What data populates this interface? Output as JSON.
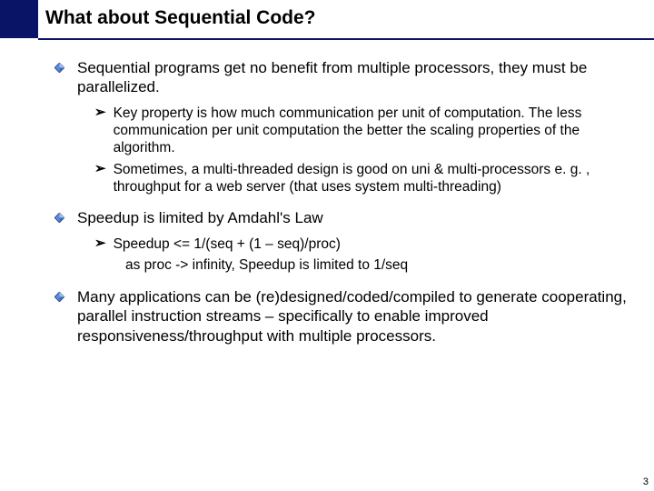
{
  "title": "What about Sequential Code?",
  "points": [
    {
      "text": "Sequential programs get no benefit from multiple processors, they must be parallelized.",
      "subs": [
        "Key property is how much communication per unit of computation. The less communication per unit computation the better the scaling properties of the algorithm.",
        "Sometimes, a multi-threaded design is good on uni & multi-processors e. g. , throughput for a web server (that uses system multi-threading)"
      ]
    },
    {
      "text": "Speedup is limited by Amdahl's Law",
      "subs": [
        "Speedup <=  1/(seq + (1 – seq)/proc)"
      ],
      "indent_line": "as proc -> infinity, Speedup is limited to 1/seq"
    },
    {
      "text": "Many applications can be (re)designed/coded/compiled to generate cooperating, parallel instruction streams – specifically to enable improved responsiveness/throughput with multiple processors.",
      "subs": []
    }
  ],
  "page_number": "3"
}
